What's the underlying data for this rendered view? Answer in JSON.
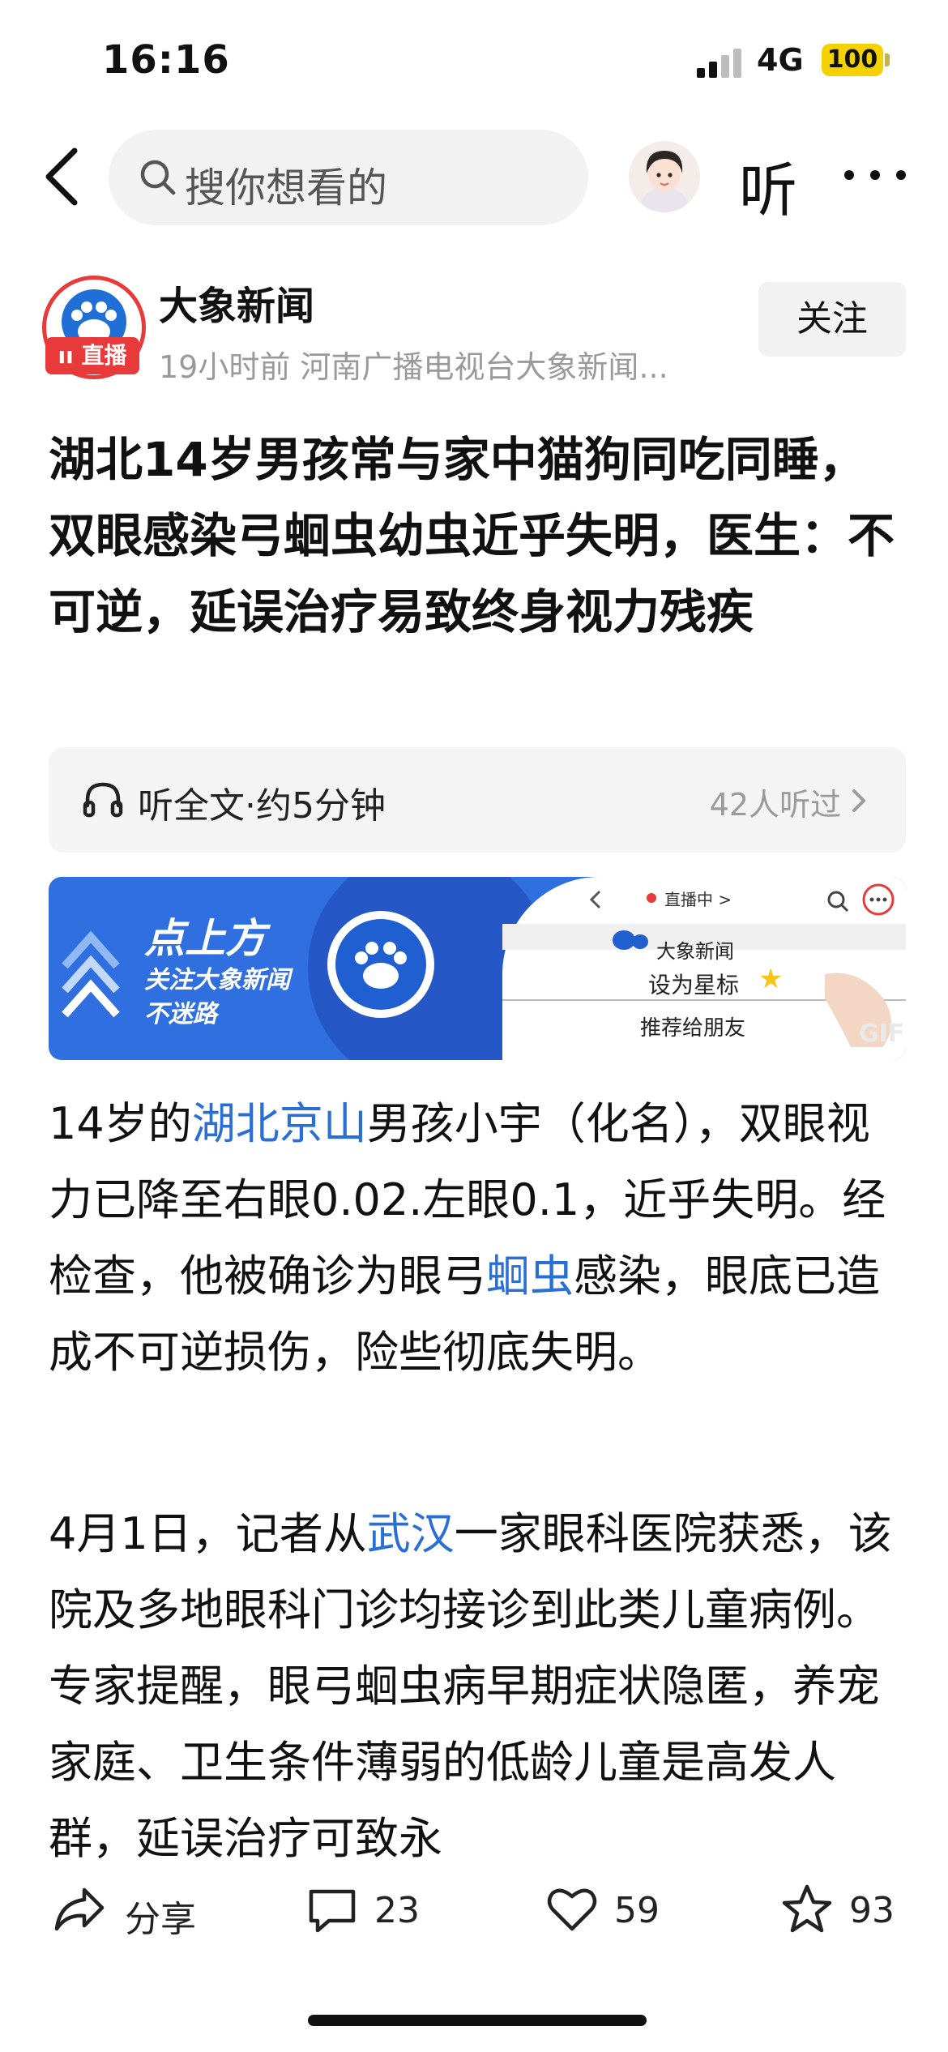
{
  "status_bar": {
    "time": "16:16",
    "network": "4G",
    "battery": "100"
  },
  "top_nav": {
    "search_placeholder": "搜你想看的",
    "listen_label": "听"
  },
  "source": {
    "name": "大象新闻",
    "live_badge": "直播",
    "meta": "19小时前  河南广播电视台大象新闻...",
    "follow_label": "关注"
  },
  "article": {
    "title": "湖北14岁男孩常与家中猫狗同吃同睡，双眼感染弓蛔虫幼虫近乎失明，医生：不可逆，延误治疗易致终身视力残疾",
    "listen_bar": {
      "label": "听全文·约5分钟",
      "count": "42人听过"
    },
    "banner": {
      "title": "点上方",
      "line1": "关注大象新闻",
      "line2": "不迷路",
      "phone_live": "直播中 >",
      "phone_name": "大象新闻",
      "phone_star": "设为星标",
      "phone_recommend": "推荐给朋友",
      "phone_gif": "GIF"
    },
    "p1": {
      "t1": "14岁的",
      "link1": "湖北京山",
      "t2": "男孩小宇（化名），双眼视力已降至右眼0.02.左眼0.1，近乎失明。经检查，他被确诊为眼弓",
      "link2": "蛔虫",
      "t3": "感染，眼底已造成不可逆损伤，险些彻底失明。"
    },
    "p2": {
      "t1": "4月1日，记者从",
      "link1": "武汉",
      "t2": "一家眼科医院获悉，该院及多地眼科门诊均接诊到此类儿童病例。专家提醒，眼弓蛔虫病早期症状隐匿，养宠家庭、卫生条件薄弱的低龄儿童是高发人群，延误治疗可致永"
    }
  },
  "actions": {
    "share": "分享",
    "comments": "23",
    "likes": "59",
    "favorites": "93"
  },
  "colors": {
    "accent": "#2a6fd6",
    "brand_red": "#e83a3a",
    "banner_blue": "#2f6fdf",
    "battery": "#f5d100"
  }
}
